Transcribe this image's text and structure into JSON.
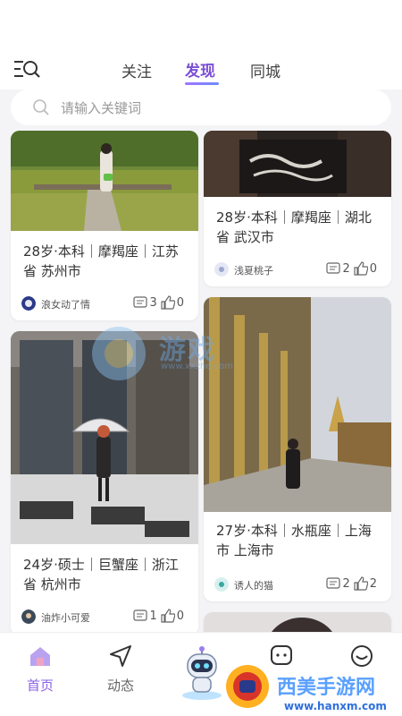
{
  "header": {
    "tabs": [
      {
        "label": "关注",
        "active": false
      },
      {
        "label": "发现",
        "active": true
      },
      {
        "label": "同城",
        "active": false
      }
    ],
    "menu_icon": "menu-search-icon"
  },
  "search": {
    "placeholder": "请输入关键词",
    "icon": "search-icon"
  },
  "feed": {
    "cards": [
      {
        "desc": "28岁·本科｜摩羯座｜江苏省 苏州市",
        "user": "浪女动了情",
        "comments": "3",
        "likes": "0"
      },
      {
        "desc": "28岁·本科｜摩羯座｜湖北省 武汉市",
        "user": "浅夏桃子",
        "comments": "2",
        "likes": "0"
      },
      {
        "desc": "24岁·硕士｜巨蟹座｜浙江省 杭州市",
        "user": "油炸小可爱",
        "comments": "1",
        "likes": "0"
      },
      {
        "desc": "27岁·本科｜水瓶座｜上海市 上海市",
        "user": "诱人的猫",
        "comments": "2",
        "likes": "2"
      }
    ]
  },
  "tabbar": {
    "items": [
      {
        "label": "首页",
        "icon": "home-icon",
        "active": true
      },
      {
        "label": "动态",
        "icon": "send-icon",
        "active": false
      },
      {
        "label": "",
        "icon": "robot-icon",
        "active": false
      },
      {
        "label": "",
        "icon": "message-icon",
        "active": false
      },
      {
        "label": "",
        "icon": "smile-icon",
        "active": false
      }
    ]
  },
  "watermarks": {
    "center": "游戏",
    "center_url": "www.xxzhe.com",
    "corner": "西美手游网",
    "corner_url": "www.hanxm.com"
  },
  "colors": {
    "accent": "#8a62e6",
    "background": "#f4f4f6"
  }
}
